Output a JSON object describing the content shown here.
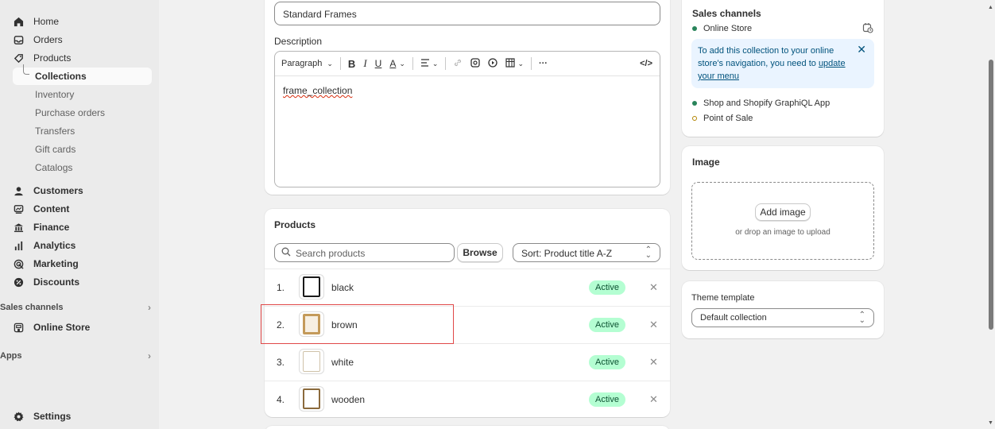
{
  "sidebar": {
    "home": "Home",
    "orders": "Orders",
    "products": "Products",
    "collections": "Collections",
    "inventory": "Inventory",
    "purchase_orders": "Purchase orders",
    "transfers": "Transfers",
    "gift_cards": "Gift cards",
    "catalogs": "Catalogs",
    "customers": "Customers",
    "content": "Content",
    "finance": "Finance",
    "analytics": "Analytics",
    "marketing": "Marketing",
    "discounts": "Discounts",
    "sales_channels_label": "Sales channels",
    "online_store": "Online Store",
    "apps_label": "Apps",
    "settings": "Settings"
  },
  "collection": {
    "title_value": "Standard Frames",
    "description_label": "Description",
    "description_text": "frame_collection"
  },
  "editor_toolbar": {
    "paragraph": "Paragraph",
    "bold": "B",
    "italic": "I",
    "underline": "U",
    "text_color": "A",
    "more": "···",
    "code": "</>"
  },
  "products_card": {
    "heading": "Products",
    "search_placeholder": "Search products",
    "browse_label": "Browse",
    "sort_label": "Sort: Product title A-Z",
    "rows": [
      {
        "index": "1.",
        "name": "black",
        "status": "Active",
        "frame_color": "#1a1a1a"
      },
      {
        "index": "2.",
        "name": "brown",
        "status": "Active",
        "frame_color": "#b08a4a"
      },
      {
        "index": "3.",
        "name": "white",
        "status": "Active",
        "frame_color": "#d9d0c0"
      },
      {
        "index": "4.",
        "name": "wooden",
        "status": "Active",
        "frame_color": "#8b6a3c"
      }
    ]
  },
  "sales_channels": {
    "heading": "Sales channels",
    "online_store": "Online Store",
    "banner_text": "To add this collection to your online store's navigation, you need to",
    "banner_link": "update your menu",
    "shop_app": "Shop and Shopify GraphiQL App",
    "pos": "Point of Sale"
  },
  "image_card": {
    "heading": "Image",
    "add_image": "Add image",
    "drop_hint": "or drop an image to upload"
  },
  "theme_template": {
    "label": "Theme template",
    "value": "Default collection"
  },
  "colors": {
    "active_badge_bg": "#b4fed2",
    "active_badge_text": "#0c5132",
    "online_dot": "#29845a",
    "pos_dot": "#b28400",
    "banner_bg": "#eaf4ff"
  }
}
